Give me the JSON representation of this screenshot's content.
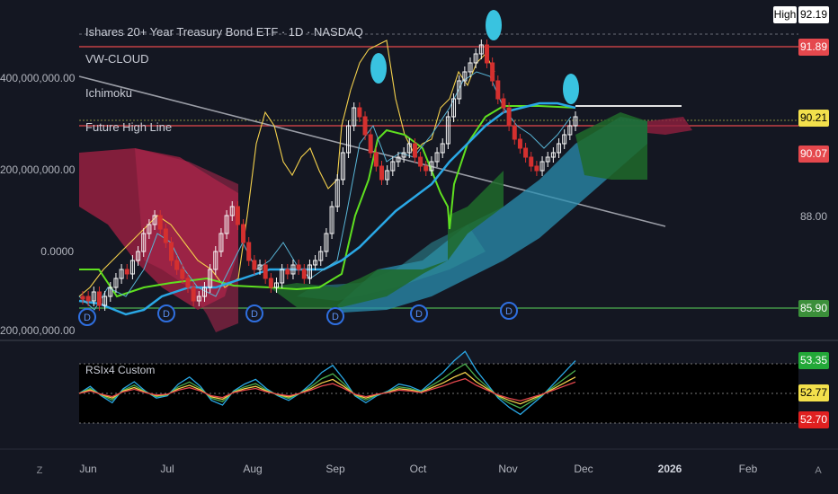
{
  "header": {
    "title": "Ishares 20+ Year Treasury Bond ETF · 1D · NASDAQ",
    "indicators": [
      "VW-CLOUD",
      "Ichimoku",
      "Future High Line"
    ]
  },
  "left_axis": [
    "400,000,000.00",
    "200,000,000.00",
    "0.0000",
    "-200,000,000.00"
  ],
  "price_tags": {
    "high_label": "High",
    "high": "92.19",
    "red_top": "91.89",
    "yellow": "90.21",
    "red_mid": "90.07",
    "plain": "88.00",
    "green": "85.90"
  },
  "rsi": {
    "label": "RSIx4 Custom",
    "green": "53.35",
    "yellow": "52.77",
    "red": "52.70"
  },
  "x_axis": [
    "Jun",
    "Jul",
    "Aug",
    "Sep",
    "Oct",
    "Nov",
    "Dec",
    "2026",
    "Feb"
  ],
  "corners": {
    "left": "Z",
    "right": "A"
  },
  "dividend_marker": "D",
  "colors": {
    "background": "#141722",
    "red_line": "#e5484d",
    "green_line": "#4caf50",
    "candle_up": "#f5f5f5",
    "candle_down": "#d4302f",
    "cloud_red": "#8e1f3e",
    "cloud_teal": "#2a8fb0",
    "cloud_green": "#1f6a2a",
    "yellow_line": "#f3d04c",
    "blue_line": "#2aa8e6",
    "lime_line": "#5fe020",
    "grey_trend": "#9a9da6"
  }
}
